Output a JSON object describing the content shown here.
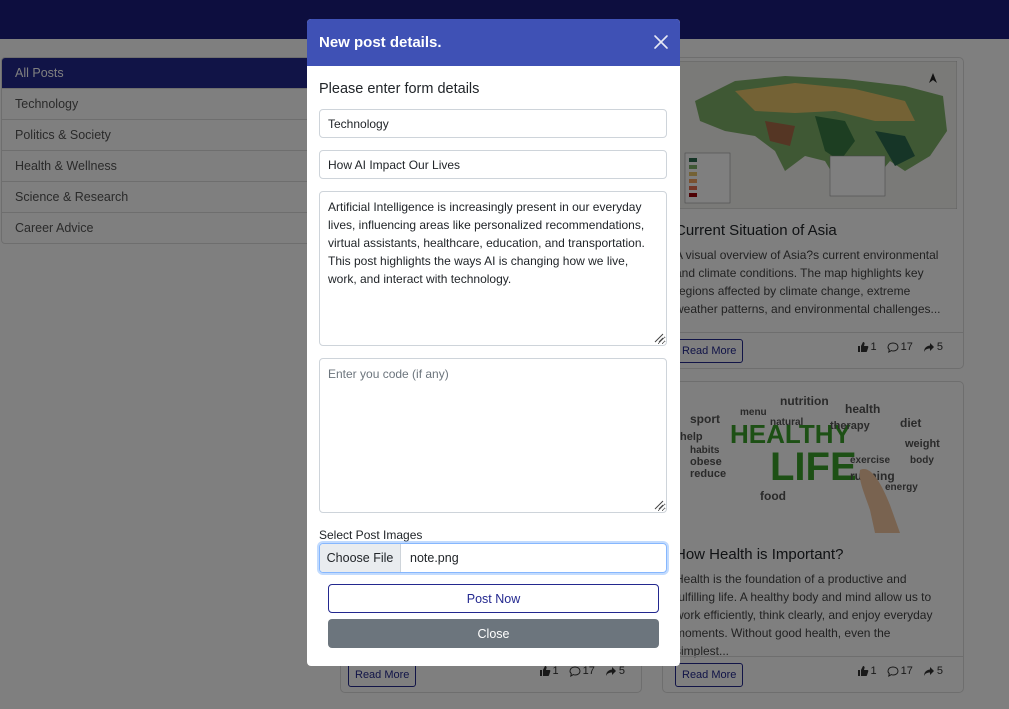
{
  "sidebar": {
    "items": [
      {
        "label": "All Posts",
        "active": true
      },
      {
        "label": "Technology"
      },
      {
        "label": "Politics & Society"
      },
      {
        "label": "Health & Wellness"
      },
      {
        "label": "Science & Research"
      },
      {
        "label": "Career Advice"
      }
    ]
  },
  "posts": [
    {
      "title": "Current Situation of Asia",
      "excerpt": "A visual overview of Asia?s current environmental and climate conditions. The map highlights key regions affected by climate change, extreme weather patterns, and environmental challenges...",
      "read_more": "Read More",
      "likes": "1",
      "comments": "17",
      "shares": "5",
      "image": "map-of-south-asia"
    },
    {
      "title": "How Health is Important?",
      "excerpt": "Health is the foundation of a productive and fulfilling life. A healthy body and mind allow us to work efficiently, think clearly, and enjoy everyday moments. Without good health, even the simplest...",
      "read_more": "Read More",
      "likes": "1",
      "comments": "17",
      "shares": "5",
      "image": "healthy-life-word-cloud",
      "image_words": [
        "HEALTHY",
        "LIFE",
        "nutrition",
        "health",
        "sport",
        "diet",
        "running",
        "food",
        "help",
        "obese",
        "reduce",
        "menu",
        "natural",
        "therapy",
        "weight",
        "body",
        "energy",
        "habits",
        "exercise"
      ]
    },
    {
      "read_more": "Read More",
      "likes": "1",
      "comments": "17",
      "shares": "5"
    }
  ],
  "modal": {
    "title": "New post details.",
    "heading": "Please enter form details",
    "category_value": "Technology",
    "title_value": "How AI Impact Our Lives",
    "content_value": "Artificial Intelligence is increasingly present in our everyday lives, influencing areas like personalized recommendations, virtual assistants, healthcare, education, and transportation. This post highlights the ways AI is changing how we live, work, and interact with technology.",
    "code_placeholder": "Enter you code (if any)",
    "file_label": "Select Post Images",
    "file_button": "Choose File",
    "file_name": "note.png",
    "post_button": "Post Now",
    "close_button": "Close"
  },
  "colors": {
    "navbar": "#1a1d7e",
    "primary": "#3f51b5",
    "accent": "#23288f",
    "secondary": "#6c757d"
  },
  "icons": [
    "close-icon",
    "like-icon",
    "comment-icon",
    "share-icon"
  ]
}
